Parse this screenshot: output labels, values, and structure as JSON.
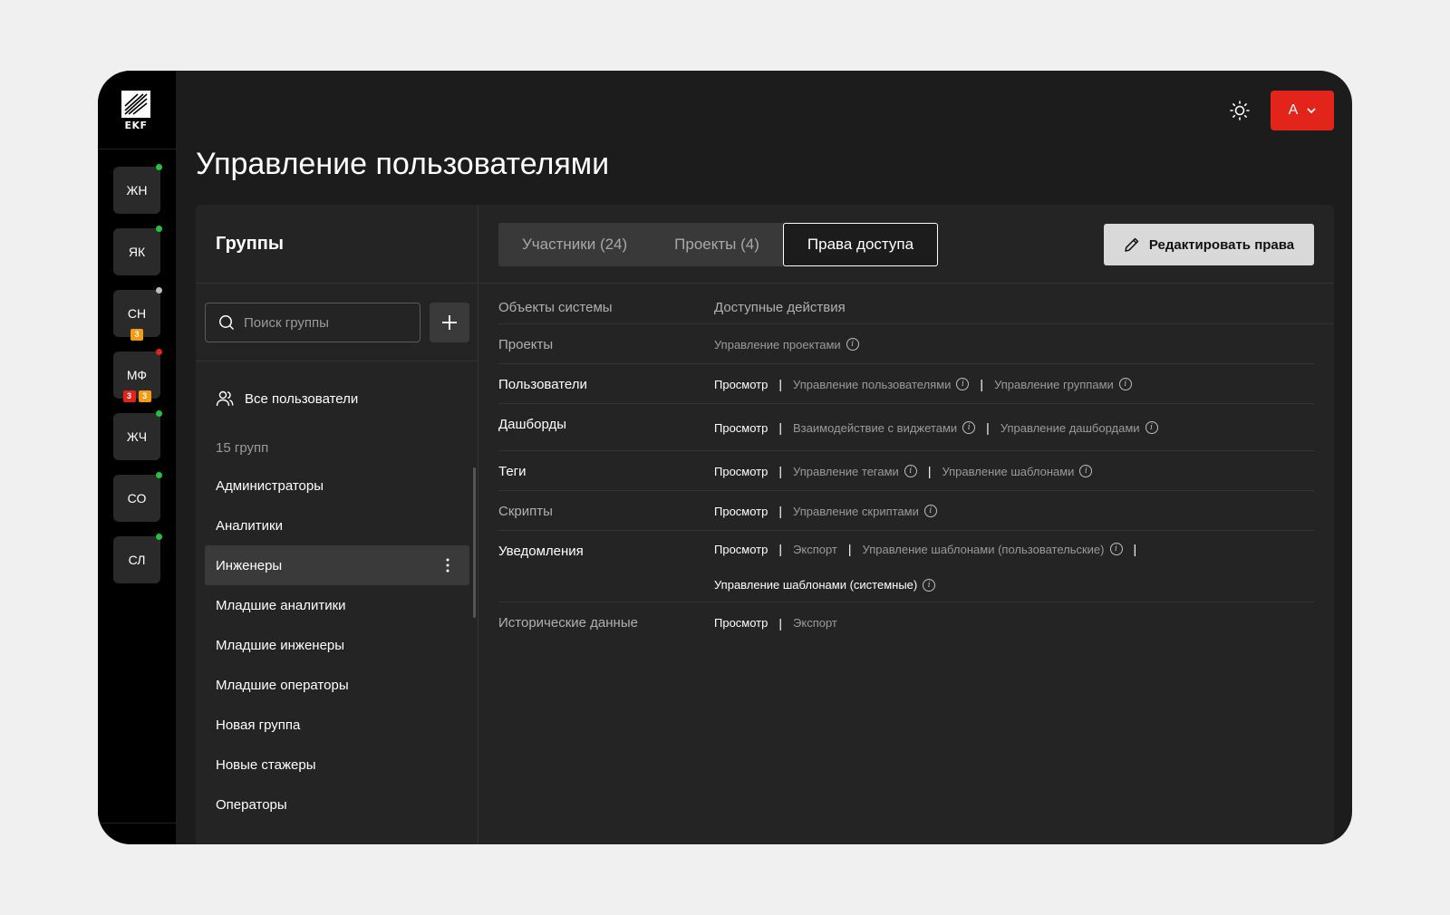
{
  "app": {
    "logo_text": "EKF",
    "page_title": "Управление пользователями",
    "theme_icon": "sun-icon",
    "user_initial": "А",
    "colors": {
      "accent": "#e3241b",
      "online": "#25c240",
      "away": "#bdbdbd",
      "alert": "#e3241b",
      "badge_orange": "#f39c12",
      "badge_red": "#e3241b"
    }
  },
  "workspaces": [
    {
      "label": "ЖН",
      "status": "online",
      "badges": []
    },
    {
      "label": "ЯК",
      "status": "online",
      "badges": []
    },
    {
      "label": "СН",
      "status": "away",
      "badges": [
        {
          "value": "3",
          "color": "orange"
        }
      ]
    },
    {
      "label": "МФ",
      "status": "alert",
      "badges": [
        {
          "value": "3",
          "color": "red"
        },
        {
          "value": "3",
          "color": "orange"
        }
      ]
    },
    {
      "label": "ЖЧ",
      "status": "online",
      "badges": []
    },
    {
      "label": "СО",
      "status": "online",
      "badges": []
    },
    {
      "label": "СЛ",
      "status": "online",
      "badges": []
    }
  ],
  "groups_panel": {
    "title": "Группы",
    "search_placeholder": "Поиск группы",
    "all_users": "Все пользователи",
    "count": "15 групп",
    "items": [
      "Администраторы",
      "Аналитики",
      "Инженеры",
      "Младшие аналитики",
      "Младшие инженеры",
      "Младшие операторы",
      "Новая группа",
      "Новые стажеры",
      "Операторы"
    ]
  },
  "tabs": [
    {
      "label": "Участники (24)",
      "active": false
    },
    {
      "label": "Проекты (4)",
      "active": false
    },
    {
      "label": "Права доступа",
      "active": true
    }
  ],
  "edit_button": "Редактировать права",
  "table": {
    "col_objects": "Объекты системы",
    "col_actions": "Доступные действия",
    "rows": [
      {
        "object": "Проекты",
        "enabled": false,
        "actions": [
          {
            "label": "Управление проектами",
            "enabled": false,
            "info": true
          }
        ]
      },
      {
        "object": "Пользователи",
        "enabled": true,
        "actions": [
          {
            "label": "Просмотр",
            "enabled": true,
            "info": false
          },
          {
            "label": "Управление пользователями",
            "enabled": false,
            "info": true
          },
          {
            "label": "Управление группами",
            "enabled": false,
            "info": true
          }
        ]
      },
      {
        "object": "Дашборды",
        "enabled": true,
        "actions": [
          {
            "label": "Просмотр",
            "enabled": true,
            "info": false
          },
          {
            "label": "Взаимодействие с виджетами",
            "enabled": false,
            "info": true
          },
          {
            "label": "Управление дашбордами",
            "enabled": false,
            "info": true
          }
        ]
      },
      {
        "object": "Теги",
        "enabled": true,
        "actions": [
          {
            "label": "Просмотр",
            "enabled": true,
            "info": false
          },
          {
            "label": "Управление тегами",
            "enabled": false,
            "info": true
          },
          {
            "label": "Управление шаблонами",
            "enabled": false,
            "info": true
          }
        ]
      },
      {
        "object": "Скрипты",
        "enabled": false,
        "actions": [
          {
            "label": "Просмотр",
            "enabled": true,
            "info": false
          },
          {
            "label": "Управление скриптами",
            "enabled": false,
            "info": true
          }
        ]
      },
      {
        "object": "Уведомления",
        "enabled": true,
        "actions": [
          {
            "label": "Просмотр",
            "enabled": true,
            "info": false
          },
          {
            "label": "Экспорт",
            "enabled": false,
            "info": false
          },
          {
            "label": "Управление шаблонами (пользовательские)",
            "enabled": false,
            "info": true
          },
          {
            "label": "Управление шаблонами (системные)",
            "enabled": true,
            "info": true,
            "newline": true
          }
        ]
      },
      {
        "object": "Исторические данные",
        "enabled": false,
        "actions": [
          {
            "label": "Просмотр",
            "enabled": true,
            "info": false
          },
          {
            "label": "Экспорт",
            "enabled": false,
            "info": false
          }
        ]
      }
    ]
  }
}
